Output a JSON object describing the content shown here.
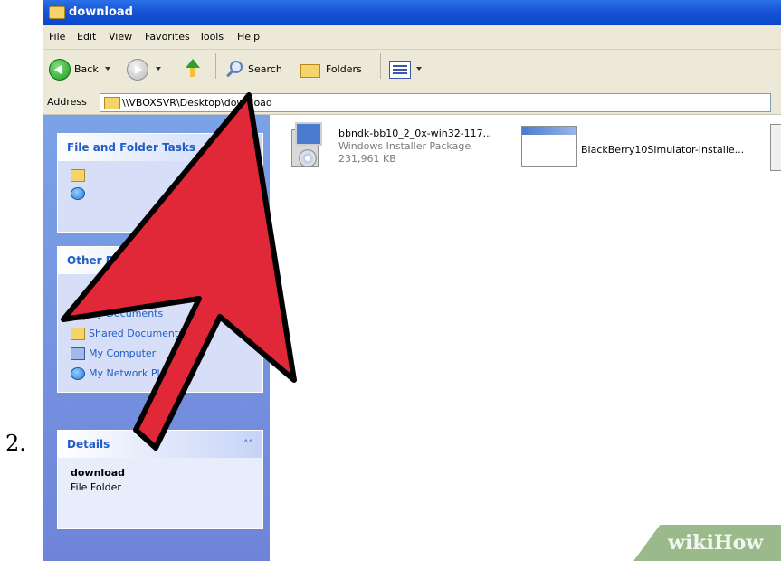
{
  "step_number": "2.",
  "window": {
    "title": "download"
  },
  "menu": [
    "File",
    "Edit",
    "View",
    "Favorites",
    "Tools",
    "Help"
  ],
  "toolbar": {
    "back_label": "Back",
    "search_label": "Search",
    "folders_label": "Folders"
  },
  "address": {
    "label": "Address",
    "value": "\\\\VBOXSVR\\Desktop\\download"
  },
  "tasks_panel": {
    "file_folder_tasks_title": "File and Folder Tasks",
    "other_places_title": "Other Places",
    "other_places_items": [
      "My Documents",
      "Shared Documents",
      "My Computer",
      "My Network Places"
    ],
    "details_title": "Details",
    "details_name": "download",
    "details_type": "File Folder"
  },
  "files": [
    {
      "name": "bbndk-bb10_2_0x-win32-117...",
      "type": "Windows Installer Package",
      "size": "231,961 KB"
    },
    {
      "name": "BlackBerry10Simulator-Installe..."
    }
  ],
  "watermark": "wikiHow",
  "colors": {
    "arrow_fill": "#e02838",
    "arrow_stroke": "#000000",
    "titlebar": "#1654d4",
    "task_link": "#215dc6"
  }
}
